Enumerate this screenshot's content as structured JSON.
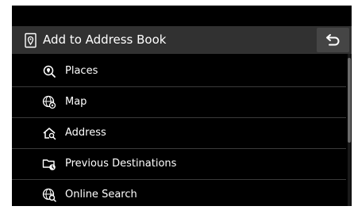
{
  "header": {
    "title": "Add to Address Book",
    "title_icon": "address-book-pin-icon",
    "back_icon": "back-arrow-icon"
  },
  "menu": {
    "items": [
      {
        "label": "Places",
        "icon": "places-search-icon"
      },
      {
        "label": "Map",
        "icon": "map-globe-icon"
      },
      {
        "label": "Address",
        "icon": "address-house-icon"
      },
      {
        "label": "Previous Destinations",
        "icon": "previous-destinations-folder-icon"
      },
      {
        "label": "Online Search",
        "icon": "online-search-globe-icon"
      }
    ]
  },
  "colors": {
    "background": "#000000",
    "header_bg": "#313131",
    "back_button_bg": "#454545",
    "text": "#ffffff",
    "divider": "#3a3a3a",
    "scroll_thumb": "#6a6a6a"
  }
}
